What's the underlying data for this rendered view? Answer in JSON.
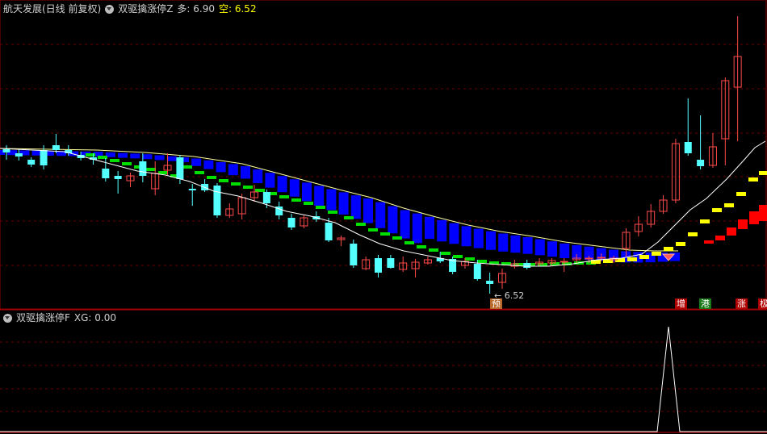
{
  "main_header": {
    "stock_label": "航天发展(日线 前复权)",
    "indicator_name": "双驱擒涨停Z",
    "duo_label": "多: 6.90",
    "kong_label": "空: 6.52"
  },
  "sub_header": {
    "indicator_name": "双驱擒涨停F",
    "xg_label": "XG: 0.00"
  },
  "low_marker": "6.52",
  "signals": [
    {
      "text": "预",
      "bg": "#b8682a"
    },
    {
      "text": "增",
      "bg": "#b00000"
    },
    {
      "text": "港",
      "bg": "#1a7a1a"
    },
    {
      "text": "涨",
      "bg": "#b00000"
    },
    {
      "text": "极",
      "bg": "#b00000"
    }
  ],
  "colors": {
    "background": "#000000",
    "grid": "#6b0000",
    "up": "#ff4a4a",
    "down": "#54ffff",
    "ma": "#ffffff",
    "channel_blue": "#0000ff",
    "green_bars": "#00e000",
    "yellow_bars": "#ffff00",
    "red_bars": "#ff0000",
    "label_white": "#d0d0d0",
    "kong_yellow": "#ffff00"
  },
  "chart_data": {
    "type": "candlestick",
    "candles": [
      {
        "o": 185,
        "c": 189,
        "h": 180,
        "l": 198
      },
      {
        "o": 190,
        "c": 194,
        "h": 185,
        "l": 199
      },
      {
        "o": 198,
        "c": 204,
        "h": 195,
        "l": 207
      },
      {
        "o": 186,
        "c": 205,
        "h": 180,
        "l": 210
      },
      {
        "o": 180,
        "c": 186,
        "h": 166,
        "l": 190
      },
      {
        "o": 186,
        "c": 190,
        "h": 180,
        "l": 193
      },
      {
        "o": 192,
        "c": 196,
        "h": 188,
        "l": 199
      },
      {
        "o": 195,
        "c": 198,
        "h": 190,
        "l": 204
      },
      {
        "o": 209,
        "c": 221,
        "h": 196,
        "l": 225
      },
      {
        "o": 218,
        "c": 222,
        "h": 212,
        "l": 240
      },
      {
        "o": 224,
        "c": 218,
        "h": 214,
        "l": 232
      },
      {
        "o": 200,
        "c": 218,
        "h": 190,
        "l": 226
      },
      {
        "o": 234,
        "c": 215,
        "h": 200,
        "l": 242
      },
      {
        "o": 211,
        "c": 205,
        "h": 190,
        "l": 217
      },
      {
        "o": 195,
        "c": 222,
        "h": 192,
        "l": 228
      },
      {
        "o": 234,
        "c": 236,
        "h": 228,
        "l": 255
      },
      {
        "o": 228,
        "c": 236,
        "h": 222,
        "l": 238
      },
      {
        "o": 230,
        "c": 267,
        "h": 227,
        "l": 270
      },
      {
        "o": 267,
        "c": 259,
        "h": 252,
        "l": 270
      },
      {
        "o": 265,
        "c": 245,
        "h": 240,
        "l": 272
      },
      {
        "o": 245,
        "c": 238,
        "h": 229,
        "l": 250
      },
      {
        "o": 238,
        "c": 252,
        "h": 235,
        "l": 258
      },
      {
        "o": 256,
        "c": 267,
        "h": 250,
        "l": 272
      },
      {
        "o": 270,
        "c": 282,
        "h": 265,
        "l": 285
      },
      {
        "o": 280,
        "c": 270,
        "h": 266,
        "l": 283
      },
      {
        "o": 268,
        "c": 272,
        "h": 262,
        "l": 275
      },
      {
        "o": 276,
        "c": 298,
        "h": 270,
        "l": 300
      },
      {
        "o": 297,
        "c": 295,
        "h": 292,
        "l": 305
      },
      {
        "o": 302,
        "c": 329,
        "h": 297,
        "l": 332
      },
      {
        "o": 333,
        "c": 322,
        "h": 318,
        "l": 335
      },
      {
        "o": 320,
        "c": 338,
        "h": 316,
        "l": 344
      },
      {
        "o": 320,
        "c": 332,
        "h": 316,
        "l": 333
      },
      {
        "o": 334,
        "c": 326,
        "h": 318,
        "l": 337
      },
      {
        "o": 333,
        "c": 325,
        "h": 321,
        "l": 344
      },
      {
        "o": 326,
        "c": 322,
        "h": 318,
        "l": 328
      },
      {
        "o": 320,
        "c": 324,
        "h": 312,
        "l": 326
      },
      {
        "o": 321,
        "c": 337,
        "h": 318,
        "l": 340
      },
      {
        "o": 329,
        "c": 324,
        "h": 320,
        "l": 333
      },
      {
        "o": 327,
        "c": 346,
        "h": 322,
        "l": 348
      },
      {
        "o": 348,
        "c": 352,
        "h": 338,
        "l": 364
      },
      {
        "o": 350,
        "c": 339,
        "h": 333,
        "l": 358
      },
      {
        "o": 330,
        "c": 327,
        "h": 322,
        "l": 333
      },
      {
        "o": 326,
        "c": 332,
        "h": 322,
        "l": 334
      },
      {
        "o": 327,
        "c": 325,
        "h": 320,
        "l": 330
      },
      {
        "o": 326,
        "c": 323,
        "h": 320,
        "l": 330
      },
      {
        "o": 325,
        "c": 324,
        "h": 320,
        "l": 337
      },
      {
        "o": 322,
        "c": 320,
        "h": 315,
        "l": 326
      },
      {
        "o": 321,
        "c": 320,
        "h": 317,
        "l": 326
      },
      {
        "o": 320,
        "c": 319,
        "h": 314,
        "l": 324
      },
      {
        "o": 322,
        "c": 320,
        "h": 317,
        "l": 326
      },
      {
        "o": 308,
        "c": 288,
        "h": 283,
        "l": 318
      },
      {
        "o": 287,
        "c": 278,
        "h": 268,
        "l": 293
      },
      {
        "o": 278,
        "c": 262,
        "h": 253,
        "l": 282
      },
      {
        "o": 262,
        "c": 248,
        "h": 242,
        "l": 265
      },
      {
        "o": 248,
        "c": 178,
        "h": 172,
        "l": 252
      },
      {
        "o": 176,
        "c": 190,
        "h": 122,
        "l": 193
      },
      {
        "o": 198,
        "c": 206,
        "h": 143,
        "l": 210
      },
      {
        "o": 205,
        "c": 182,
        "h": 165,
        "l": 208
      },
      {
        "o": 172,
        "c": 100,
        "h": 96,
        "l": 205
      },
      {
        "o": 108,
        "c": 70,
        "h": 20,
        "l": 175
      }
    ],
    "ma_line": [
      [
        0,
        184
      ],
      [
        40,
        186
      ],
      [
        80,
        188
      ],
      [
        110,
        196
      ],
      [
        140,
        204
      ],
      [
        170,
        212
      ],
      [
        205,
        217
      ],
      [
        235,
        225
      ],
      [
        265,
        237
      ],
      [
        295,
        243
      ],
      [
        325,
        252
      ],
      [
        355,
        262
      ],
      [
        385,
        268
      ],
      [
        415,
        276
      ],
      [
        445,
        291
      ],
      [
        470,
        302
      ],
      [
        500,
        311
      ],
      [
        530,
        317
      ],
      [
        560,
        323
      ],
      [
        590,
        326
      ],
      [
        620,
        328
      ],
      [
        650,
        330
      ],
      [
        680,
        330
      ],
      [
        710,
        327
      ],
      [
        740,
        322
      ],
      [
        770,
        320
      ],
      [
        795,
        315
      ],
      [
        815,
        300
      ],
      [
        835,
        280
      ],
      [
        855,
        260
      ],
      [
        875,
        246
      ],
      [
        900,
        222
      ],
      [
        920,
        200
      ],
      [
        935,
        183
      ],
      [
        948,
        175
      ]
    ],
    "channel_top": [
      [
        0,
        184
      ],
      [
        60,
        185
      ],
      [
        120,
        186
      ],
      [
        180,
        189
      ],
      [
        240,
        194
      ],
      [
        300,
        203
      ],
      [
        330,
        211
      ],
      [
        360,
        219
      ],
      [
        390,
        227
      ],
      [
        420,
        235
      ],
      [
        460,
        245
      ],
      [
        500,
        258
      ],
      [
        540,
        269
      ],
      [
        580,
        279
      ],
      [
        620,
        287
      ],
      [
        660,
        293
      ],
      [
        700,
        300
      ],
      [
        740,
        305
      ],
      [
        780,
        310
      ],
      [
        810,
        311
      ],
      [
        840,
        311
      ]
    ],
    "channel_bottom": [
      [
        0,
        186
      ],
      [
        60,
        188
      ],
      [
        120,
        192
      ],
      [
        180,
        200
      ],
      [
        240,
        212
      ],
      [
        300,
        228
      ],
      [
        330,
        235
      ],
      [
        360,
        245
      ],
      [
        390,
        256
      ],
      [
        420,
        266
      ],
      [
        460,
        275
      ],
      [
        500,
        288
      ],
      [
        540,
        300
      ],
      [
        580,
        310
      ],
      [
        620,
        316
      ],
      [
        660,
        320
      ],
      [
        700,
        321
      ],
      [
        740,
        322
      ],
      [
        780,
        322
      ],
      [
        810,
        318
      ],
      [
        840,
        313
      ]
    ]
  },
  "sub_chart_data": {
    "type": "line",
    "name": "XG",
    "values": [
      0,
      0,
      0,
      1,
      0,
      0
    ],
    "peak_x": 828,
    "ylim": [
      0,
      1
    ]
  }
}
